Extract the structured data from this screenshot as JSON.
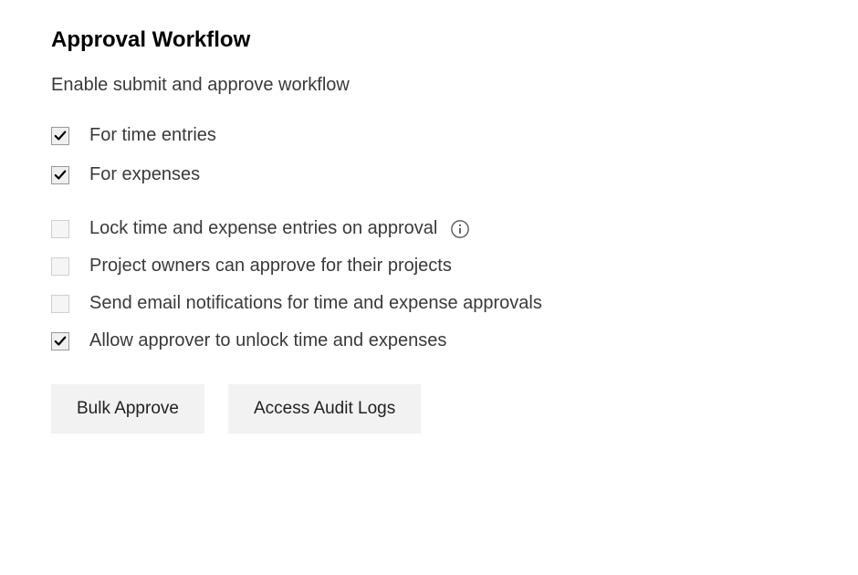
{
  "section": {
    "title": "Approval Workflow",
    "subtitle": "Enable submit and approve workflow"
  },
  "options_group1": [
    {
      "label": "For time entries",
      "checked": true
    },
    {
      "label": "For expenses",
      "checked": true
    }
  ],
  "options_group2": [
    {
      "label": "Lock time and expense entries on approval",
      "checked": false,
      "has_info": true
    },
    {
      "label": "Project owners can approve for their projects",
      "checked": false
    },
    {
      "label": "Send email notifications for time and expense approvals",
      "checked": false
    },
    {
      "label": "Allow approver to unlock time and expenses",
      "checked": true
    }
  ],
  "buttons": {
    "bulk_approve": "Bulk Approve",
    "access_audit_logs": "Access Audit Logs"
  }
}
